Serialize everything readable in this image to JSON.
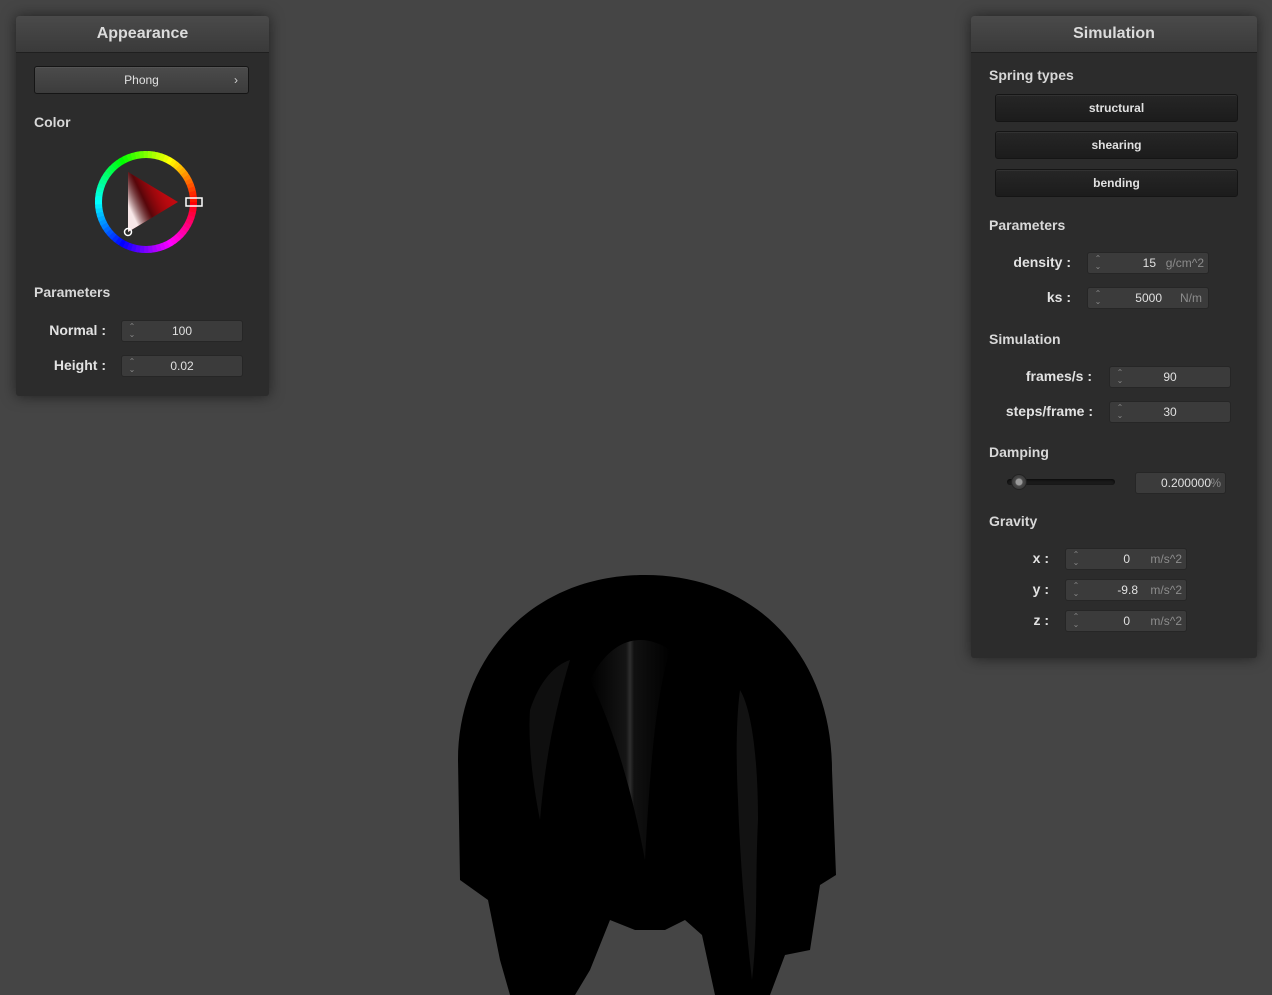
{
  "appearance": {
    "title": "Appearance",
    "shader_label": "Phong",
    "color_label": "Color",
    "parameters_label": "Parameters",
    "normal_label": "Normal :",
    "normal_value": "100",
    "height_label": "Height :",
    "height_value": "0.02",
    "selected_color": "#e0141e"
  },
  "simulation": {
    "title": "Simulation",
    "spring_types_label": "Spring types",
    "spring_buttons": [
      "structural",
      "shearing",
      "bending"
    ],
    "parameters_label": "Parameters",
    "density_label": "density :",
    "density_value": "15",
    "density_unit": "g/cm^2",
    "ks_label": "ks :",
    "ks_value": "5000",
    "ks_unit": "N/m",
    "simulation_label": "Simulation",
    "fps_label": "frames/s :",
    "fps_value": "90",
    "steps_label": "steps/frame :",
    "steps_value": "30",
    "damping_label": "Damping",
    "damping_value": "0.200000",
    "damping_unit": "%",
    "damping_fraction": 0.2,
    "gravity_label": "Gravity",
    "gx_label": "x :",
    "gx_value": "0",
    "gy_label": "y :",
    "gy_value": "-9.8",
    "gz_label": "z :",
    "gz_value": "0",
    "gravity_unit": "m/s^2"
  },
  "colors": {
    "background": "#454545",
    "panel": "#2c2c2c",
    "cloth": "#000000"
  }
}
